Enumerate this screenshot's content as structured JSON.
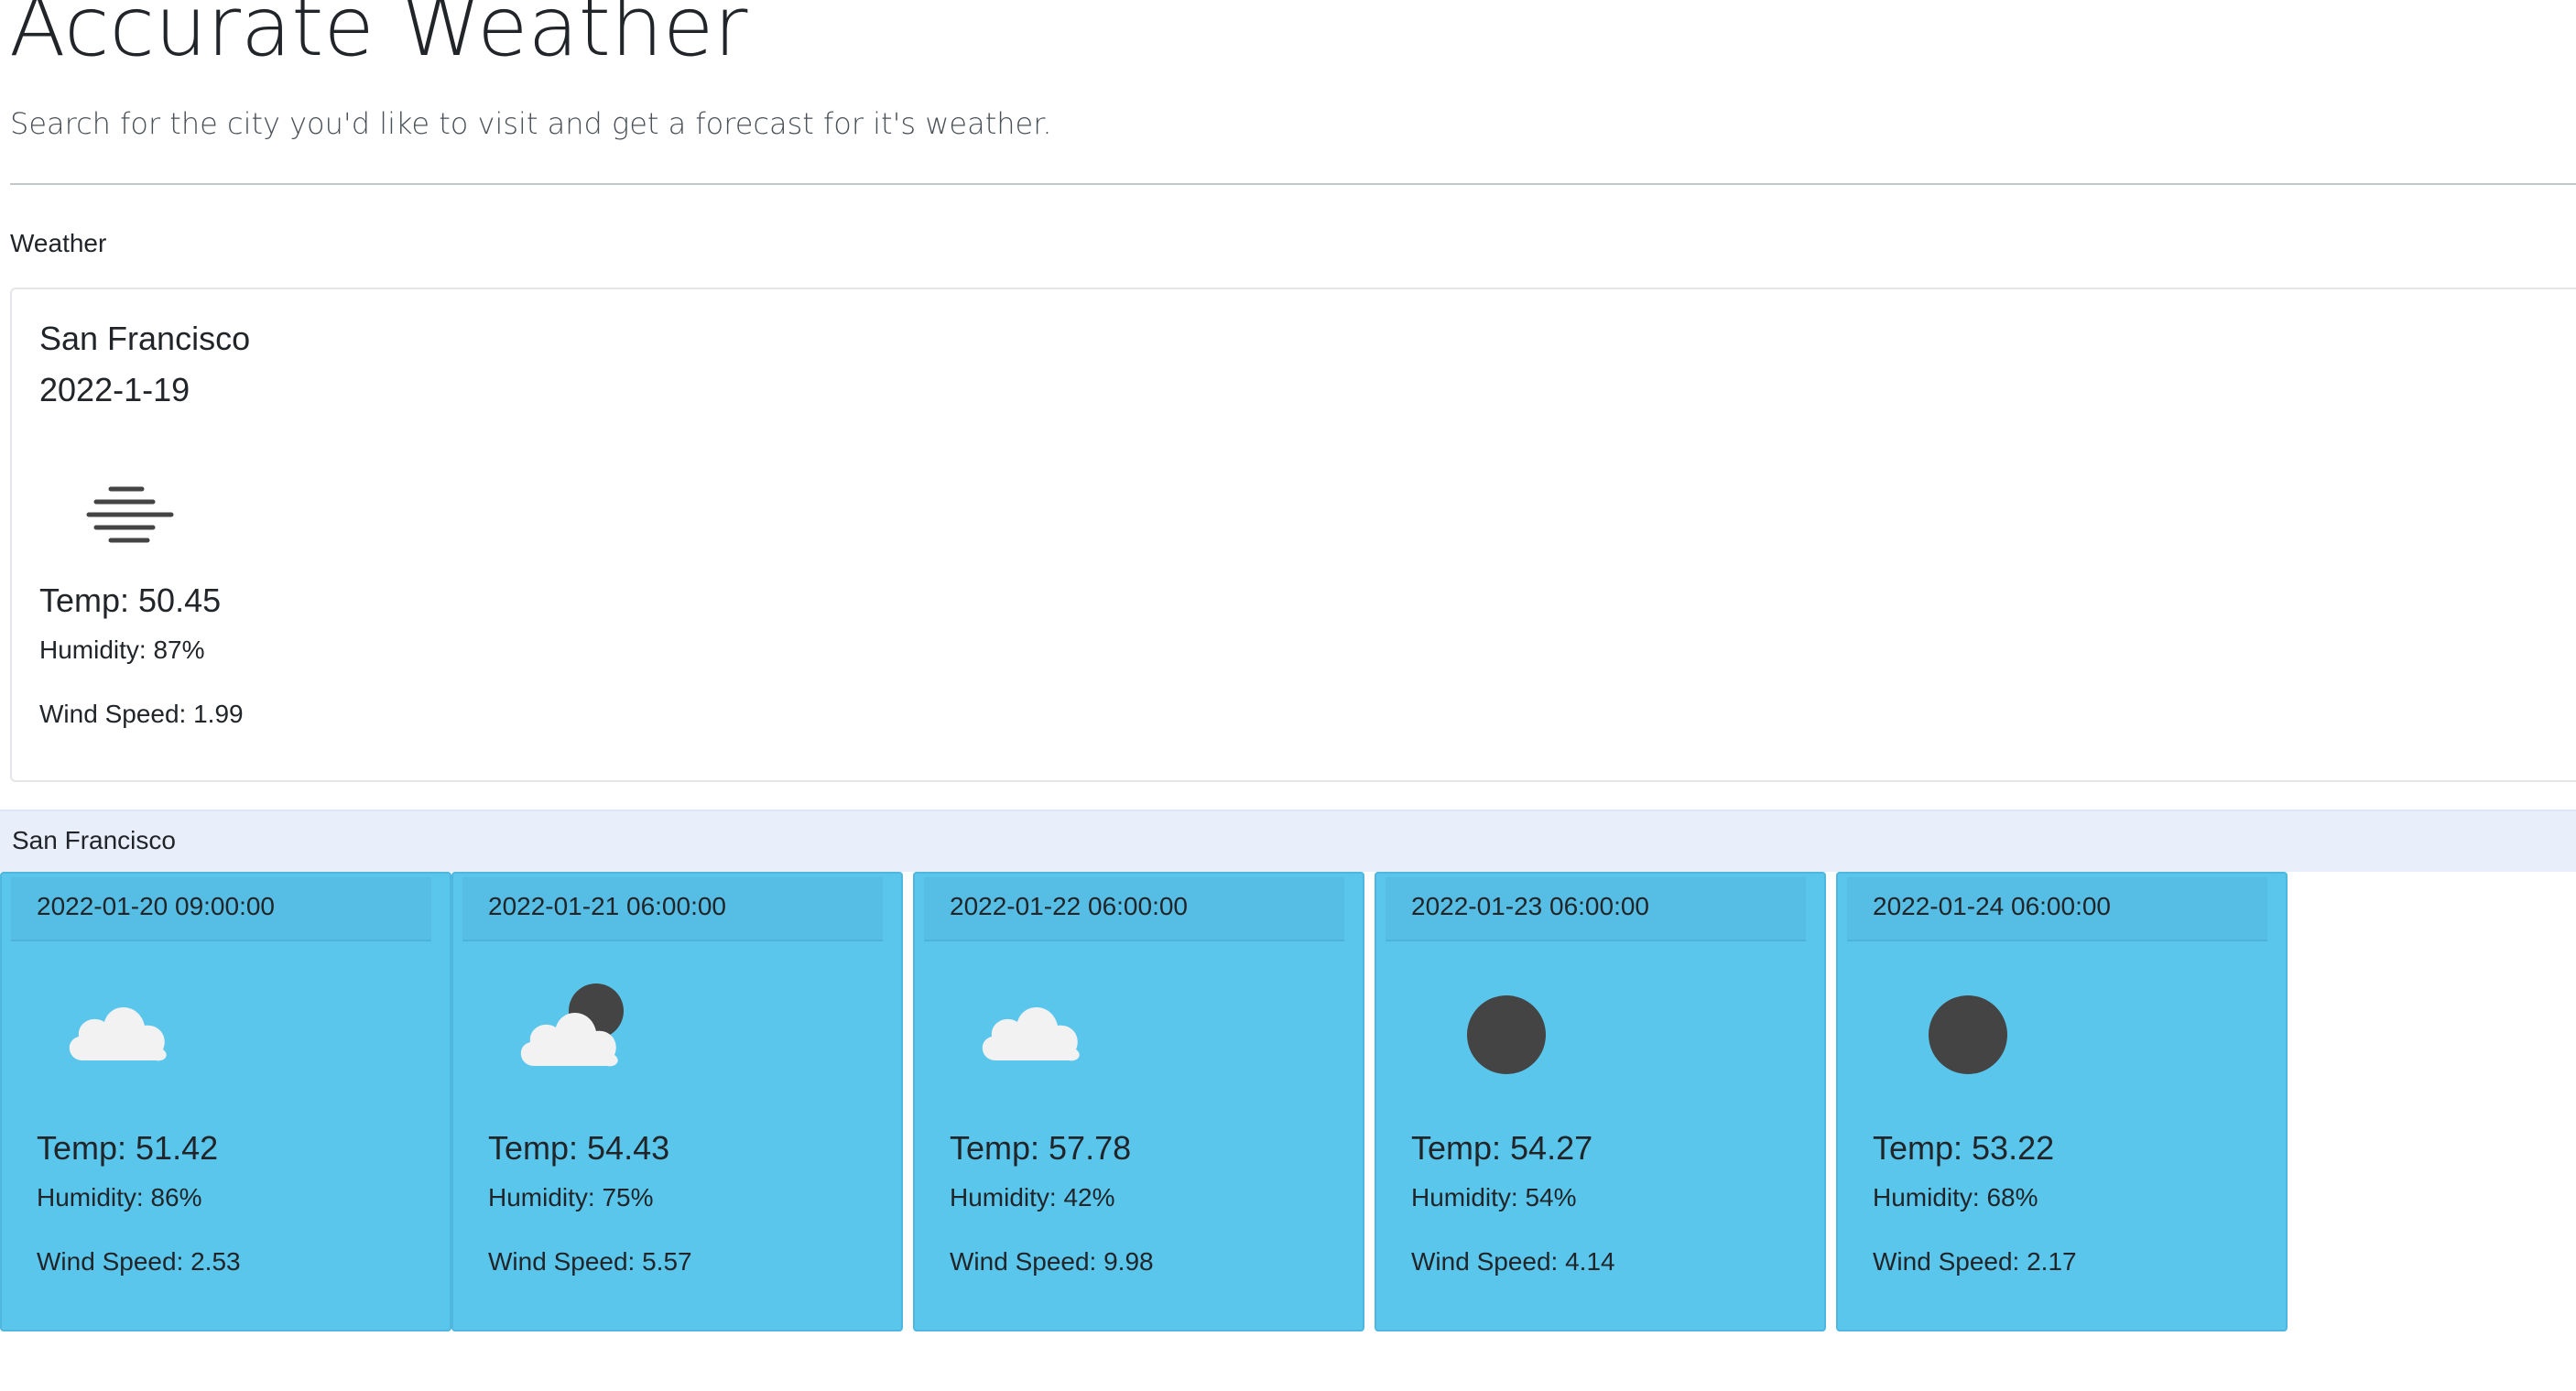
{
  "header": {
    "title": "Accurate Weather",
    "subtitle": "Search for the city you'd like to visit and get a forecast for it's weather."
  },
  "current": {
    "section_label": "Weather",
    "city": "San Francisco",
    "date": "2022-1-19",
    "icon": "mist-icon",
    "temp": "Temp: 50.45",
    "humidity": "Humidity: 87%",
    "wind": "Wind Speed: 1.99"
  },
  "forecast": {
    "city": "San Francisco",
    "days": [
      {
        "date": "2022-01-20 09:00:00",
        "icon": "cloud-icon",
        "temp": "Temp: 51.42",
        "humidity": "Humidity: 86%",
        "wind": "Wind Speed: 2.53"
      },
      {
        "date": "2022-01-21 06:00:00",
        "icon": "cloud-moon-icon",
        "temp": "Temp: 54.43",
        "humidity": "Humidity: 75%",
        "wind": "Wind Speed: 5.57"
      },
      {
        "date": "2022-01-22 06:00:00",
        "icon": "cloud-icon",
        "temp": "Temp: 57.78",
        "humidity": "Humidity: 42%",
        "wind": "Wind Speed: 9.98"
      },
      {
        "date": "2022-01-23 06:00:00",
        "icon": "moon-icon",
        "temp": "Temp: 54.27",
        "humidity": "Humidity: 54%",
        "wind": "Wind Speed: 4.14"
      },
      {
        "date": "2022-01-24 06:00:00",
        "icon": "moon-icon",
        "temp": "Temp: 53.22",
        "humidity": "Humidity: 68%",
        "wind": "Wind Speed: 2.17"
      }
    ]
  },
  "colors": {
    "forecast_card": "#5bc6ec",
    "forecast_bar": "#e8eefa",
    "icon_dark": "#444444",
    "cloud": "#f2f2f2"
  }
}
